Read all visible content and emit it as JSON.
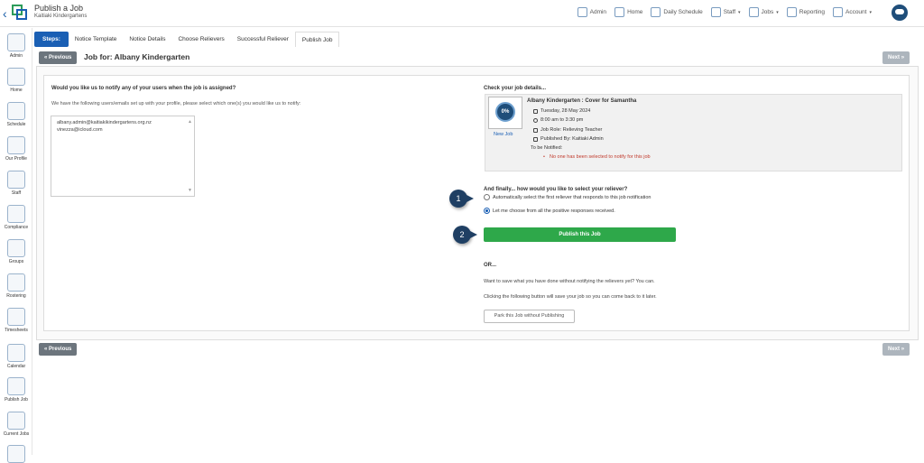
{
  "header": {
    "title": "Publish a Job",
    "subtitle": "Kaitiaki Kindergartens",
    "nav": [
      {
        "label": "Admin",
        "icon": "admin-icon"
      },
      {
        "label": "Home",
        "icon": "home-icon"
      },
      {
        "label": "Daily Schedule",
        "icon": "schedule-icon"
      },
      {
        "label": "Staff",
        "icon": "staff-icon",
        "caret": "▾"
      },
      {
        "label": "Jobs",
        "icon": "jobs-icon",
        "caret": "▾"
      },
      {
        "label": "Reporting",
        "icon": "reporting-icon"
      },
      {
        "label": "Account",
        "icon": "account-icon",
        "caret": "▾"
      }
    ]
  },
  "sidebar": {
    "items": [
      {
        "label": "Admin"
      },
      {
        "label": "Home"
      },
      {
        "label": "Schedule"
      },
      {
        "label": "Our Profile"
      },
      {
        "label": "Staff"
      },
      {
        "label": "Compliance"
      },
      {
        "label": "Groups"
      },
      {
        "label": "Rostering"
      },
      {
        "label": "Timesheets"
      },
      {
        "label": "Calendar"
      },
      {
        "label": "Publish Job"
      },
      {
        "label": "Current Jobs"
      }
    ]
  },
  "steps": {
    "label": "Steps:",
    "tabs": [
      "Notice Template",
      "Notice Details",
      "Choose Relievers",
      "Successful Reliever",
      "Publish Job"
    ],
    "active_index": 4
  },
  "nav_buttons": {
    "previous": "Previous",
    "next": "Next"
  },
  "job_for": "Job for: Albany Kindergarten",
  "notify": {
    "question": "Would you like us to notify any of your users when the job is assigned?",
    "description": "We have the following users/emails set up with your profile, please select which one(s) you would like us to notify:",
    "emails": [
      "albany.admin@kaitiakikindergartens.org.nz",
      "vinezza@icloud.com"
    ]
  },
  "check": {
    "title": "Check your job details...",
    "job_badge": "0%",
    "job_badge_label": "New Job",
    "job_title": "Albany Kindergarten : Cover for Samantha",
    "date": "Tuesday, 28 May 2024",
    "time": "8:00 am to 3:30 pm",
    "role": "Job Role: Relieving Teacher",
    "published_by": "Published By: Kaitiaki Admin",
    "to_be_notified": "To be Notified:",
    "notified_none": "No one has been selected to notify for this job"
  },
  "finally": {
    "question": "And finally... how would you like to select your reliever?",
    "options": [
      {
        "label": "Automatically select the first reliever that responds to this job notification",
        "selected": false
      },
      {
        "label": "Let me choose from all the positive responses received.",
        "selected": true
      }
    ]
  },
  "markers": [
    "1",
    "2"
  ],
  "publish_label": "Publish this Job",
  "or_section": {
    "or": "OR...",
    "save_text": "Want to save what you have done without notifying the relievers yet? You can.",
    "click_text": "Clicking the following button will save your job so you can come back to it later.",
    "park_label": "Park this Job without Publishing"
  },
  "colors": {
    "primary": "#1a5fb4",
    "success": "#2ea84a",
    "marker": "#1f3f63",
    "grey_button": "#6c757d",
    "warning_text": "#c0392b"
  }
}
